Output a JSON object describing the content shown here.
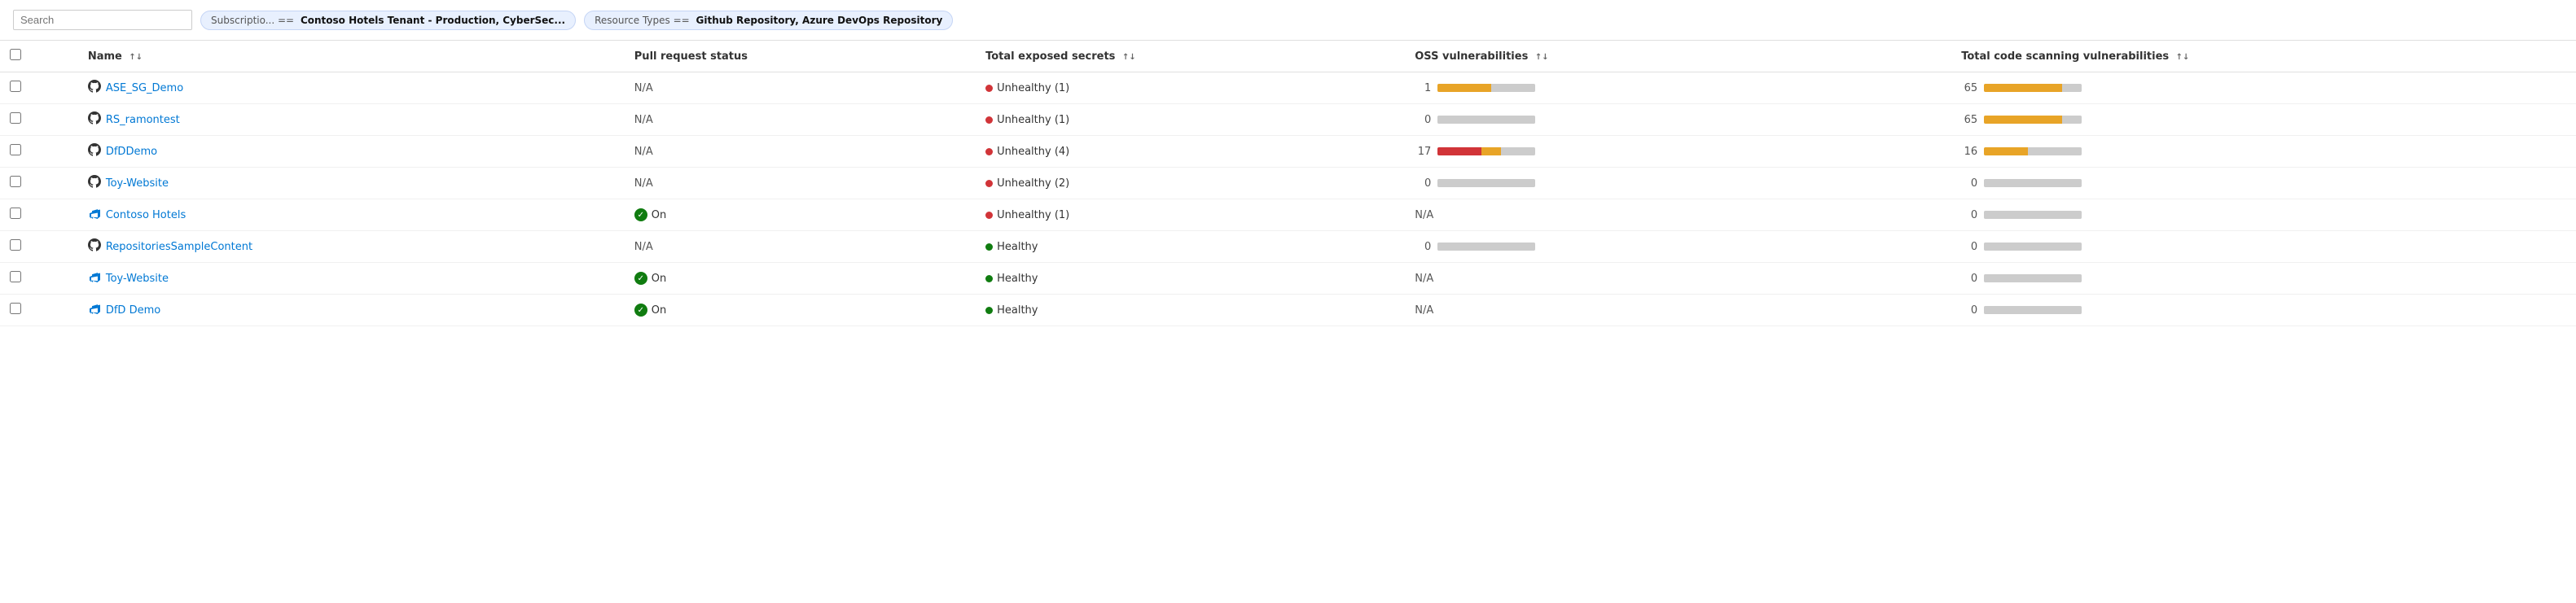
{
  "toolbar": {
    "search_placeholder": "Search",
    "filters": [
      {
        "key": "Subscriptio...",
        "operator": "==",
        "value": "Contoso Hotels Tenant - Production, CyberSec..."
      },
      {
        "key": "Resource Types",
        "operator": "==",
        "value": "Github Repository, Azure DevOps Repository"
      }
    ]
  },
  "table": {
    "columns": [
      {
        "id": "name",
        "label": "Name",
        "sortable": true
      },
      {
        "id": "pr_status",
        "label": "Pull request status",
        "sortable": false
      },
      {
        "id": "secrets",
        "label": "Total exposed secrets",
        "sortable": true
      },
      {
        "id": "oss",
        "label": "OSS vulnerabilities",
        "sortable": true
      },
      {
        "id": "codescan",
        "label": "Total code scanning vulnerabilities",
        "sortable": true
      }
    ],
    "rows": [
      {
        "id": 1,
        "icon_type": "github",
        "name": "ASE_SG_Demo",
        "pr_status": "N/A",
        "secret_dot": "red",
        "secret_label": "Unhealthy (1)",
        "oss_num": "1",
        "oss_bars": [
          {
            "color": "orange",
            "pct": 55
          }
        ],
        "codescan_num": "65",
        "codescan_bars": [
          {
            "color": "orange",
            "pct": 80
          }
        ]
      },
      {
        "id": 2,
        "icon_type": "github",
        "name": "RS_ramontest",
        "pr_status": "N/A",
        "secret_dot": "red",
        "secret_label": "Unhealthy (1)",
        "oss_num": "0",
        "oss_bars": [
          {
            "color": "gray",
            "pct": 40
          }
        ],
        "codescan_num": "65",
        "codescan_bars": [
          {
            "color": "orange",
            "pct": 80
          }
        ]
      },
      {
        "id": 3,
        "icon_type": "github",
        "name": "DfDDemo",
        "pr_status": "N/A",
        "secret_dot": "red",
        "secret_label": "Unhealthy (4)",
        "oss_num": "17",
        "oss_bars": [
          {
            "color": "red",
            "pct": 45
          },
          {
            "color": "orange",
            "pct": 20
          }
        ],
        "codescan_num": "16",
        "codescan_bars": [
          {
            "color": "orange",
            "pct": 45
          }
        ]
      },
      {
        "id": 4,
        "icon_type": "github",
        "name": "Toy-Website",
        "pr_status": "N/A",
        "secret_dot": "red",
        "secret_label": "Unhealthy (2)",
        "oss_num": "0",
        "oss_bars": [
          {
            "color": "gray",
            "pct": 40
          }
        ],
        "codescan_num": "0",
        "codescan_bars": [
          {
            "color": "gray",
            "pct": 40
          }
        ]
      },
      {
        "id": 5,
        "icon_type": "devops",
        "name": "Contoso Hotels",
        "pr_status": "On",
        "secret_dot": "red",
        "secret_label": "Unhealthy (1)",
        "oss_num": "N/A",
        "oss_bars": [],
        "codescan_num": "0",
        "codescan_bars": [
          {
            "color": "gray",
            "pct": 40
          }
        ]
      },
      {
        "id": 6,
        "icon_type": "github",
        "name": "RepositoriesSampleContent",
        "pr_status": "N/A",
        "secret_dot": "green",
        "secret_label": "Healthy",
        "oss_num": "0",
        "oss_bars": [
          {
            "color": "gray",
            "pct": 40
          }
        ],
        "codescan_num": "0",
        "codescan_bars": [
          {
            "color": "gray",
            "pct": 40
          }
        ]
      },
      {
        "id": 7,
        "icon_type": "devops",
        "name": "Toy-Website",
        "pr_status": "On",
        "secret_dot": "green",
        "secret_label": "Healthy",
        "oss_num": "N/A",
        "oss_bars": [],
        "codescan_num": "0",
        "codescan_bars": [
          {
            "color": "gray",
            "pct": 40
          }
        ]
      },
      {
        "id": 8,
        "icon_type": "devops",
        "name": "DfD Demo",
        "pr_status": "On",
        "secret_dot": "green",
        "secret_label": "Healthy",
        "oss_num": "N/A",
        "oss_bars": [],
        "codescan_num": "0",
        "codescan_bars": [
          {
            "color": "gray",
            "pct": 40
          }
        ]
      }
    ]
  }
}
